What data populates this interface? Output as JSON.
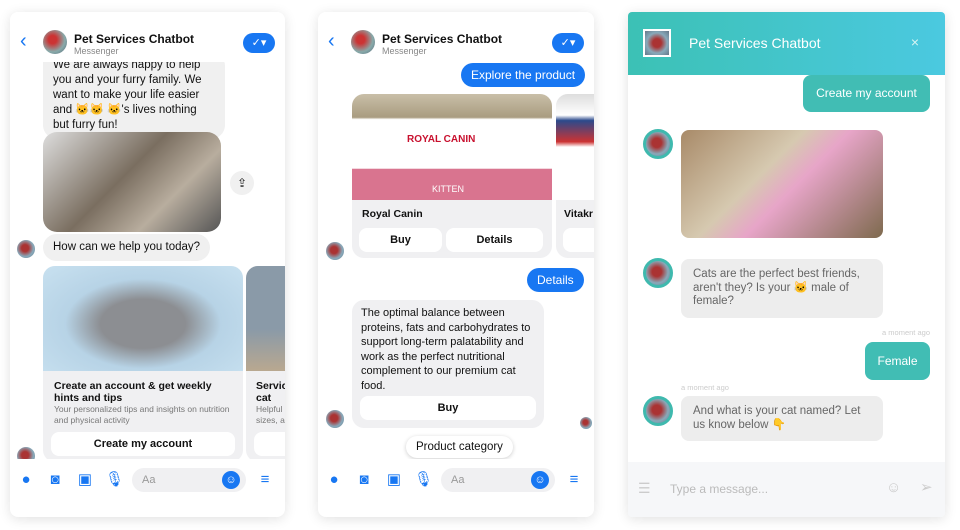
{
  "bot_name": "Pet Services Chatbot",
  "platform": "Messenger",
  "colors": {
    "messenger_blue": "#1877f2",
    "teal": "#41bdb4"
  },
  "panel1": {
    "intro": "We are always happy to help you and your furry family. We want to make your life easier and 🐱🐱 🐱's lives nothing but furry fun!",
    "question": "How can we help you today?",
    "cards": [
      {
        "title": "Create an account & get weekly hints and tips",
        "desc": "Your personalized tips and insights on nutrition and physical activity",
        "button": "Create my account"
      },
      {
        "title": "Servic cat",
        "desc": "Helpful sizes, a"
      }
    ],
    "composer_placeholder": "Aa"
  },
  "panel2": {
    "explore": "Explore the product",
    "products": [
      {
        "name": "Royal Canin",
        "label": "ROYAL CANIN",
        "variant": "KITTEN",
        "buttons": [
          "Buy",
          "Details"
        ]
      },
      {
        "name": "Vitakr",
        "label": "Vitakr"
      }
    ],
    "details_reply": "Details",
    "description": "The optimal balance between proteins, fats and carbohydrates to support long-term palatability and work as the perfect nutritional complement to our premium cat food.",
    "buy": "Buy",
    "product_category": "Product category",
    "composer_placeholder": "Aa"
  },
  "panel3": {
    "create_account": "Create my account",
    "msg1": "Cats are the perfect best friends, aren't they? Is your 🐱 male of female?",
    "ts1": "a moment ago",
    "female": "Female",
    "ts2": "a moment ago",
    "msg2": "And what is your cat named? Let us know below 👇",
    "input_placeholder": "Type a message..."
  }
}
